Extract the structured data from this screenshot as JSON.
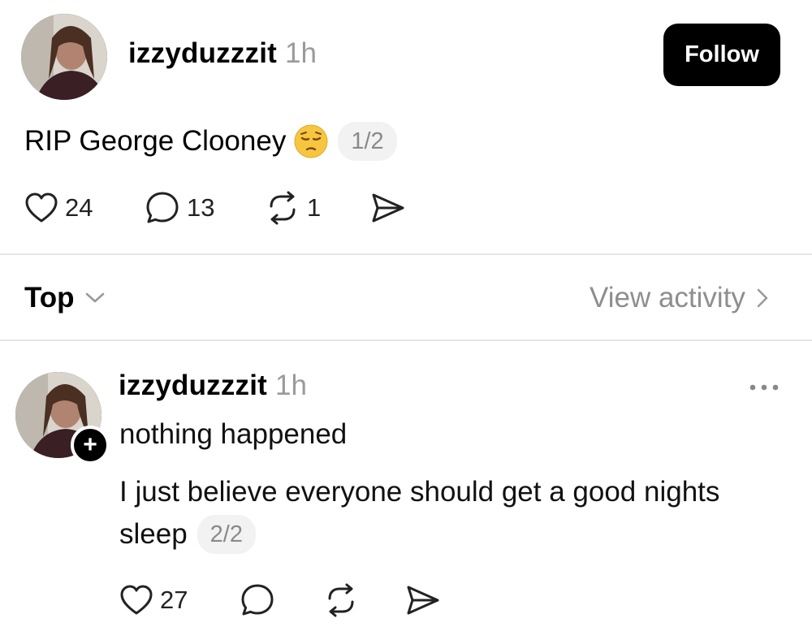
{
  "post": {
    "username": "izzyduzzzit",
    "time": "1h",
    "follow_label": "Follow",
    "text": "RIP George Clooney",
    "emoji": "😔",
    "pager": "1/2",
    "likes": "24",
    "comments": "13",
    "reposts": "1"
  },
  "sort_bar": {
    "sort_label": "Top",
    "view_activity_label": "View activity"
  },
  "reply": {
    "username": "izzyduzzzit",
    "time": "1h",
    "line1": "nothing happened",
    "line2": "I just believe everyone should get a good nights",
    "line3": "sleep",
    "pager": "2/2",
    "likes": "27",
    "plus_symbol": "+"
  },
  "icons": {
    "like": "heart-icon",
    "comment": "comment-bubble-icon",
    "repost": "repost-icon",
    "share": "share-send-icon",
    "more": "more-dots-icon",
    "chevron_down": "chevron-down-icon",
    "chevron_right": "chevron-right-icon"
  }
}
